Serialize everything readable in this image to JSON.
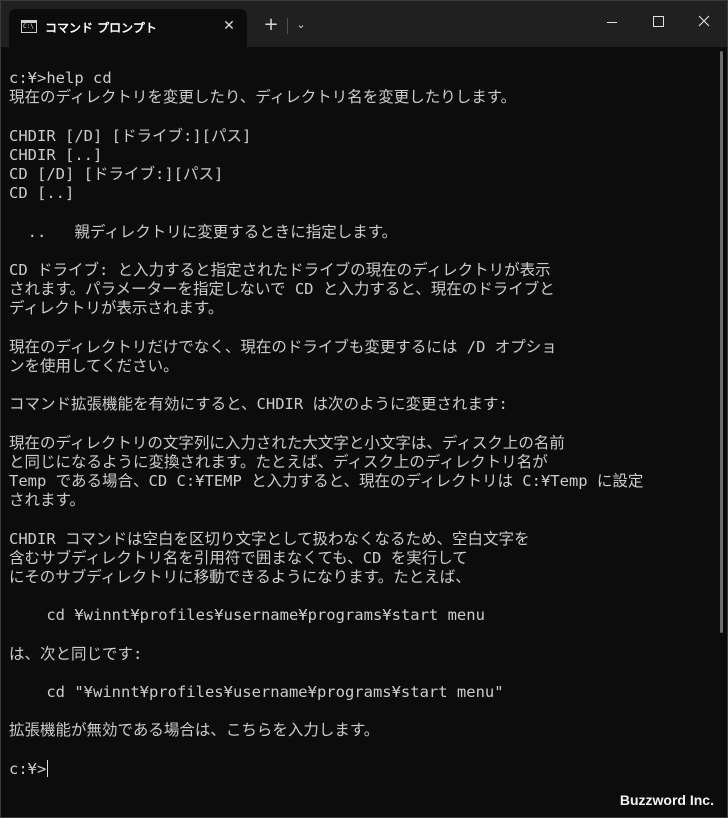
{
  "window": {
    "tab_title": "コマンド プロンプト",
    "tab_icon_text": "C:\\",
    "tab_close_glyph": "✕",
    "new_tab_glyph": "+",
    "dropdown_glyph": "⌄"
  },
  "console": {
    "lines": [
      "c:¥>help cd",
      "現在のディレクトリを変更したり、ディレクトリ名を変更したりします。",
      "",
      "CHDIR [/D] [ドライブ:][パス]",
      "CHDIR [..]",
      "CD [/D] [ドライブ:][パス]",
      "CD [..]",
      "",
      "  ..   親ディレクトリに変更するときに指定します。",
      "",
      "CD ドライブ: と入力すると指定されたドライブの現在のディレクトリが表示",
      "されます。パラメーターを指定しないで CD と入力すると、現在のドライブと",
      "ディレクトリが表示されます。",
      "",
      "現在のディレクトリだけでなく、現在のドライブも変更するには /D オプショ",
      "ンを使用してください。",
      "",
      "コマンド拡張機能を有効にすると、CHDIR は次のように変更されます:",
      "",
      "現在のディレクトリの文字列に入力された大文字と小文字は、ディスク上の名前",
      "と同じになるように変換されます。たとえば、ディスク上のディレクトリ名が",
      "Temp である場合、CD C:¥TEMP と入力すると、現在のディレクトリは C:¥Temp に設定",
      "されます。",
      "",
      "CHDIR コマンドは空白を区切り文字として扱わなくなるため、空白文字を",
      "含むサブディレクトリ名を引用符で囲まなくても、CD を実行して",
      "にそのサブディレクトリに移動できるようになります。たとえば、",
      "",
      "    cd ¥winnt¥profiles¥username¥programs¥start menu",
      "",
      "は、次と同じです:",
      "",
      "    cd \"¥winnt¥profiles¥username¥programs¥start menu\"",
      "",
      "拡張機能が無効である場合は、こちらを入力します。",
      "",
      "c:¥>"
    ]
  },
  "watermark": "Buzzword Inc.",
  "colors": {
    "console_bg": "#0c0c0c",
    "console_fg": "#cccccc",
    "titlebar_bg": "#202020"
  }
}
